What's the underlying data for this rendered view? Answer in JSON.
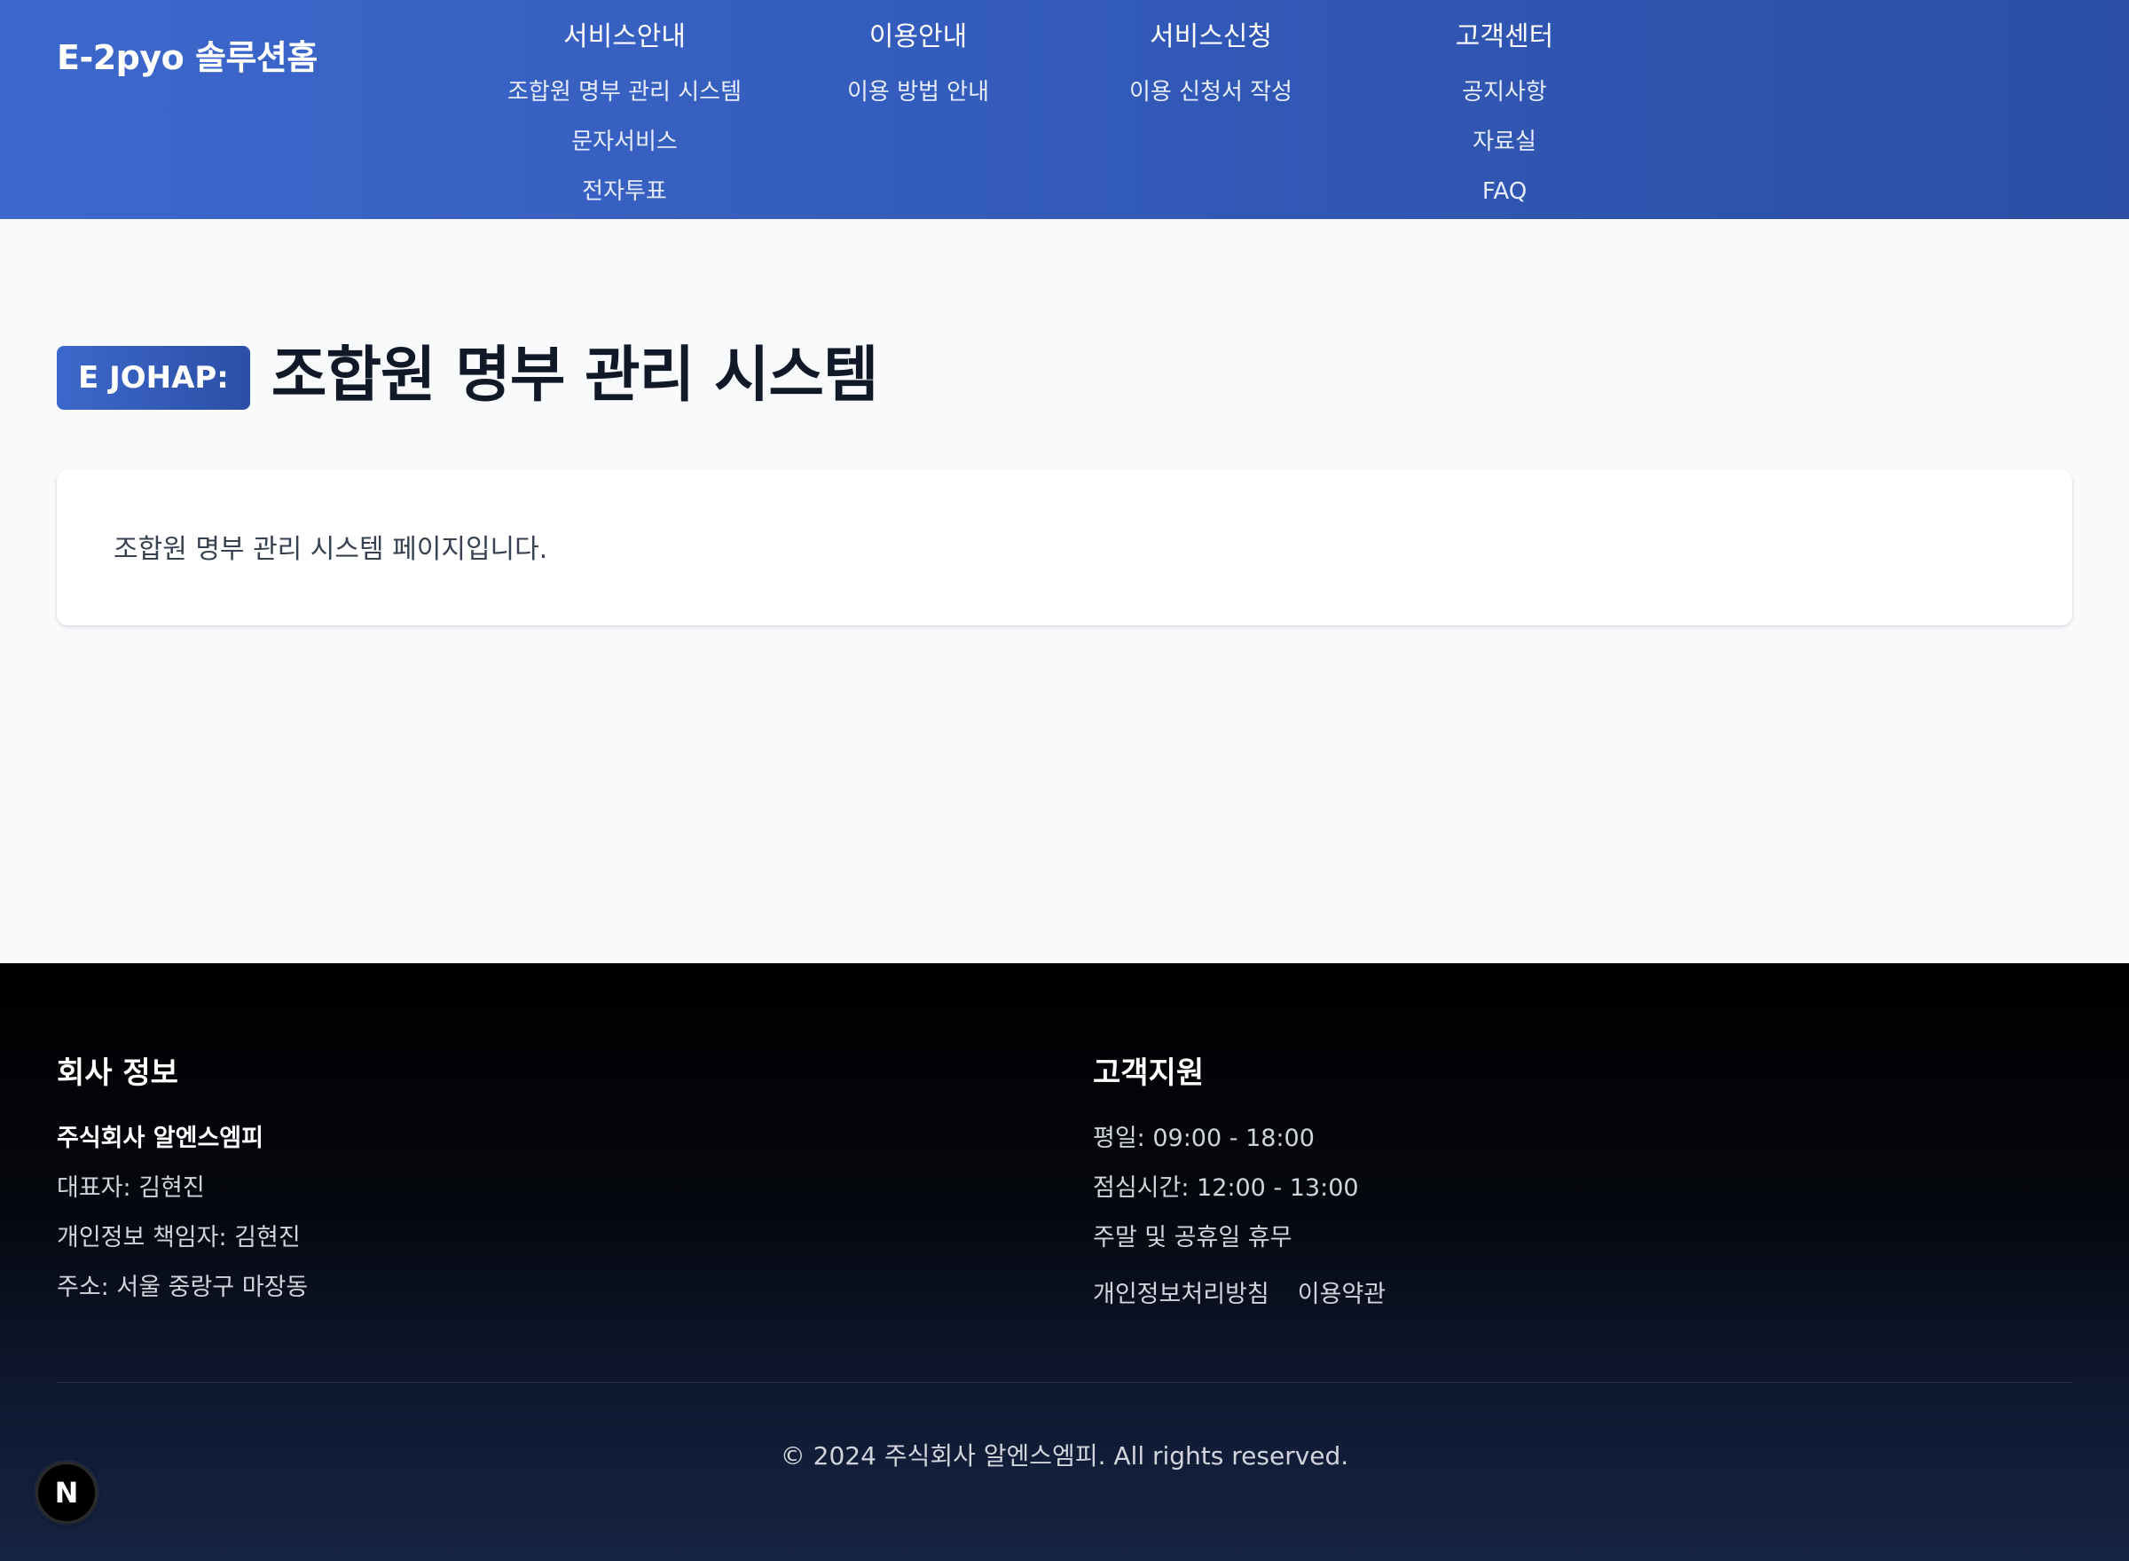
{
  "header": {
    "logo": "E-2pyo 솔루션홈",
    "nav": [
      {
        "title": "서비스안내",
        "items": [
          "조합원 명부 관리 시스템",
          "문자서비스",
          "전자투표"
        ]
      },
      {
        "title": "이용안내",
        "items": [
          "이용 방법 안내"
        ]
      },
      {
        "title": "서비스신청",
        "items": [
          "이용 신청서 작성"
        ]
      },
      {
        "title": "고객센터",
        "items": [
          "공지사항",
          "자료실",
          "FAQ"
        ]
      }
    ]
  },
  "main": {
    "badge": "E JOHAP:",
    "title": "조합원 명부 관리 시스템",
    "content": "조합원 명부 관리 시스템 페이지입니다."
  },
  "footer": {
    "company": {
      "heading": "회사 정보",
      "name": "주식회사 알엔스엠피",
      "ceo": "대표자: 김현진",
      "privacy_officer": "개인정보 책임자: 김현진",
      "address": "주소: 서울 중랑구 마장동"
    },
    "support": {
      "heading": "고객지원",
      "weekday": "평일: 09:00 - 18:00",
      "lunch": "점심시간: 12:00 - 13:00",
      "closed": "주말 및 공휴일 휴무",
      "links": [
        "개인정보처리방침",
        "이용약관"
      ]
    },
    "copyright": "© 2024 주식회사 알엔스엠피. All rights reserved."
  },
  "floating_button": {
    "label": "N"
  },
  "colors": {
    "header_gradient_start": "#3d68cc",
    "header_gradient_end": "#2c4fa5",
    "page_background": "#f8fafc",
    "footer_background": "#000000",
    "footer_gradient_end": "#162443"
  }
}
